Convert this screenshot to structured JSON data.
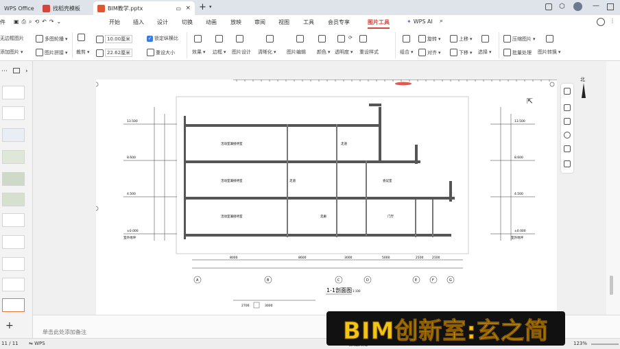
{
  "titlebar": {
    "tabs": [
      {
        "label": "WPS Office"
      },
      {
        "label": "找稻壳模板"
      },
      {
        "label": "BIM教学.pptx"
      }
    ],
    "add_tab": "+"
  },
  "menubar": {
    "file": "件",
    "items": [
      "开始",
      "插入",
      "设计",
      "切换",
      "动画",
      "放映",
      "审阅",
      "视图",
      "工具",
      "会员专享",
      "图片工具"
    ],
    "ai": "WPS AI"
  },
  "ribbon": {
    "items": [
      {
        "label": "无边框图片"
      },
      {
        "label": "多图轮播"
      },
      {
        "label": "添加图片"
      },
      {
        "label": "图片拼接"
      },
      {
        "label": "裁剪"
      },
      {
        "label": "10.00厘米"
      },
      {
        "label": "22.62厘米"
      },
      {
        "label": "锁定纵横比"
      },
      {
        "label": "重设大小"
      },
      {
        "label": "抠除背景"
      },
      {
        "label": "效果"
      },
      {
        "label": "边框"
      },
      {
        "label": "图片设计"
      },
      {
        "label": "清晰化"
      },
      {
        "label": "图片编辑"
      },
      {
        "label": "颜色"
      },
      {
        "label": "透明度"
      },
      {
        "label": "重设样式"
      },
      {
        "label": "组合"
      },
      {
        "label": "旋转"
      },
      {
        "label": "对齐"
      },
      {
        "label": "上移"
      },
      {
        "label": "下移"
      },
      {
        "label": "选择"
      },
      {
        "label": "压缩图片"
      },
      {
        "label": "批量处理"
      },
      {
        "label": "图片转换"
      }
    ],
    "checkbox_lock": true,
    "width_value": "10.00厘米",
    "height_value": "22.62厘米"
  },
  "drawing": {
    "title": "1-1剖面图",
    "scale": "1:100",
    "axes": [
      "A",
      "B",
      "C",
      "D",
      "E",
      "F",
      "G"
    ],
    "dims": [
      "8000",
      "8600",
      "3000",
      "5000",
      "2100",
      "2100"
    ],
    "rooms": [
      "活动室兼接待室",
      "走道",
      "会议室",
      "门厅",
      "走廊",
      "活动室兼接待室",
      "走道",
      "活动室兼接待室"
    ],
    "levels": [
      "13.500",
      "8.600",
      "4.500",
      "±0.000"
    ],
    "outdoor": "室外地坪",
    "bottom_dims": [
      "2700",
      "3000"
    ]
  },
  "notes": {
    "placeholder": "单击此处添加备注"
  },
  "statusbar": {
    "page": "11 / 11",
    "app": "WPS",
    "zoom": "123%",
    "beautify": "智能美化"
  },
  "watermark": {
    "text": "BIM创新室:玄之简"
  },
  "compass": {
    "label": "北"
  },
  "colors": {
    "accent": "#d6453d",
    "watermark_text": "#f0c419",
    "watermark_bg": "#111111"
  }
}
